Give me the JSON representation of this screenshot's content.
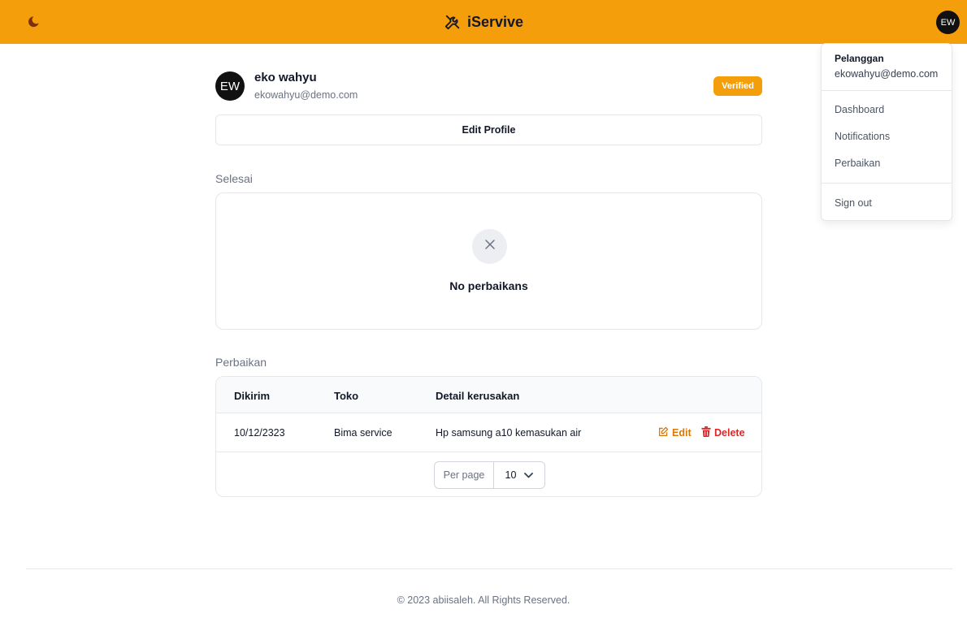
{
  "header": {
    "brand": "iServive",
    "avatar_initials": "EW",
    "theme_icon": "moon-icon",
    "brand_icon": "tools-icon",
    "background_color": "#f59e0b"
  },
  "user_menu": {
    "role": "Pelanggan",
    "email": "ekowahyu@demo.com",
    "items": [
      "Dashboard",
      "Notifications",
      "Perbaikan"
    ],
    "sign_out": "Sign out"
  },
  "profile": {
    "initials": "EW",
    "name": "eko wahyu",
    "email": "ekowahyu@demo.com",
    "badge": "Verified",
    "edit_button": "Edit Profile"
  },
  "selesai": {
    "title": "Selesai",
    "empty_icon": "close-icon",
    "empty_text": "No perbaikans"
  },
  "perbaikan": {
    "title": "Perbaikan",
    "columns": [
      "Dikirim",
      "Toko",
      "Detail kerusakan"
    ],
    "rows": [
      {
        "dikirim": "10/12/2323",
        "toko": "Bima service",
        "detail": "Hp samsung a10 kemasukan air"
      }
    ],
    "actions": {
      "edit": "Edit",
      "delete": "Delete"
    },
    "per_page_label": "Per page",
    "per_page_value": "10"
  },
  "footer": {
    "text": "© 2023 abiisaleh. All Rights Reserved."
  },
  "colors": {
    "accent": "#f59e0b",
    "edit": "#d97706",
    "delete": "#dc2626"
  }
}
